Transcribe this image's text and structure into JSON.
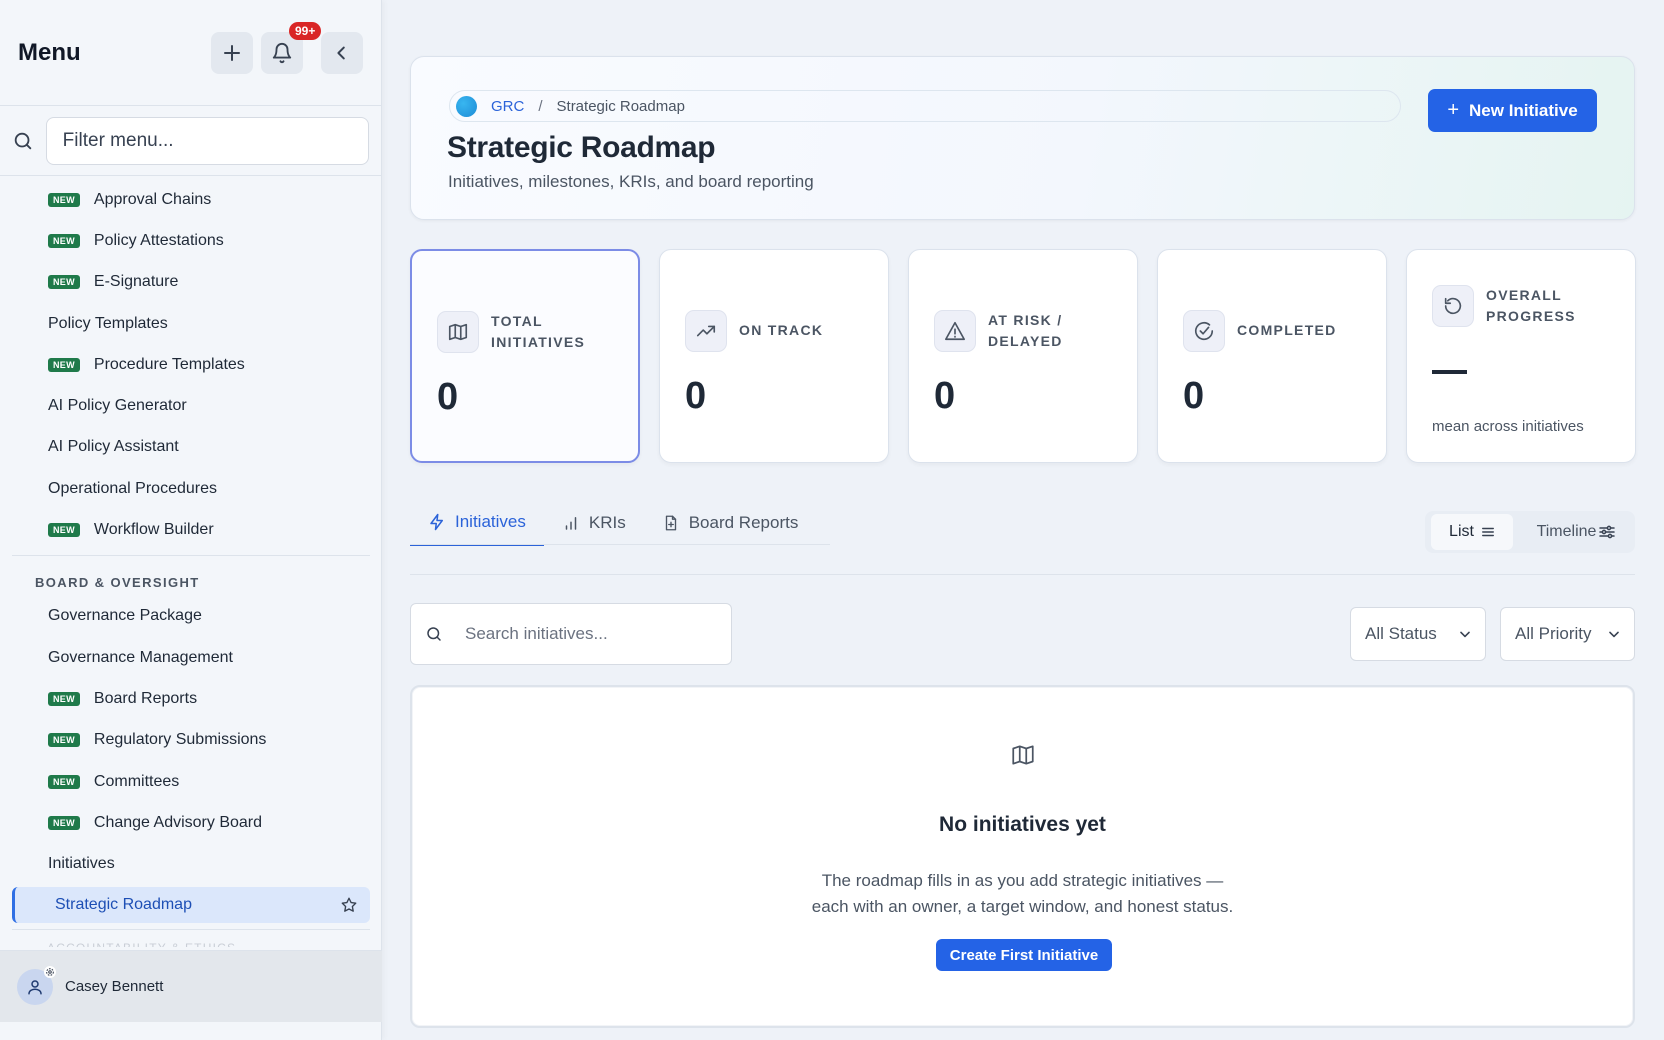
{
  "sidebar": {
    "title": "Menu",
    "notifications_badge": "99+",
    "filter_placeholder": "Filter menu...",
    "new_badge": "NEW",
    "items_top": [
      {
        "label": "Approval Chains",
        "new": true
      },
      {
        "label": "Policy Attestations",
        "new": true
      },
      {
        "label": "E-Signature",
        "new": true
      },
      {
        "label": "Policy Templates",
        "new": false
      },
      {
        "label": "Procedure Templates",
        "new": true
      },
      {
        "label": "AI Policy Generator",
        "new": false
      },
      {
        "label": "AI Policy Assistant",
        "new": false
      },
      {
        "label": "Operational Procedures",
        "new": false
      },
      {
        "label": "Workflow Builder",
        "new": true
      }
    ],
    "section_board": "BOARD & OVERSIGHT",
    "items_board": [
      {
        "label": "Governance Package",
        "new": false
      },
      {
        "label": "Governance Management",
        "new": false
      },
      {
        "label": "Board Reports",
        "new": true
      },
      {
        "label": "Regulatory Submissions",
        "new": true
      },
      {
        "label": "Committees",
        "new": true
      },
      {
        "label": "Change Advisory Board",
        "new": true
      },
      {
        "label": "Initiatives",
        "new": false
      }
    ],
    "active_item": "Strategic Roadmap",
    "next_section_faded": "ACCOUNTABILITY & ETHICS",
    "user_name": "Casey Bennett"
  },
  "header": {
    "breadcrumb_root": "GRC",
    "breadcrumb_sep": "/",
    "breadcrumb_current": "Strategic Roadmap",
    "title": "Strategic Roadmap",
    "subtitle": "Initiatives, milestones, KRIs, and board reporting",
    "new_button": "New Initiative"
  },
  "stats": {
    "total": {
      "label": "TOTAL INITIATIVES",
      "value": "0"
    },
    "on_track": {
      "label": "ON TRACK",
      "value": "0"
    },
    "at_risk": {
      "label": "AT RISK / DELAYED",
      "value": "0"
    },
    "completed": {
      "label": "COMPLETED",
      "value": "0"
    },
    "overall": {
      "label": "OVERALL PROGRESS",
      "note": "mean across initiatives"
    }
  },
  "tabs": [
    "Initiatives",
    "KRIs",
    "Board Reports"
  ],
  "view": {
    "list": "List",
    "timeline": "Timeline"
  },
  "filters": {
    "search_placeholder": "Search initiatives...",
    "status": "All Status",
    "priority": "All Priority"
  },
  "empty": {
    "title": "No initiatives yet",
    "line1": "The roadmap fills in as you add strategic initiatives —",
    "line2": "each with an owner, a target window, and honest status.",
    "cta": "Create First Initiative"
  },
  "colors": {
    "accent": "#2463e6",
    "new_badge": "#1f7a4a",
    "notif": "#d92626",
    "active_bg": "#dbe7fb"
  }
}
